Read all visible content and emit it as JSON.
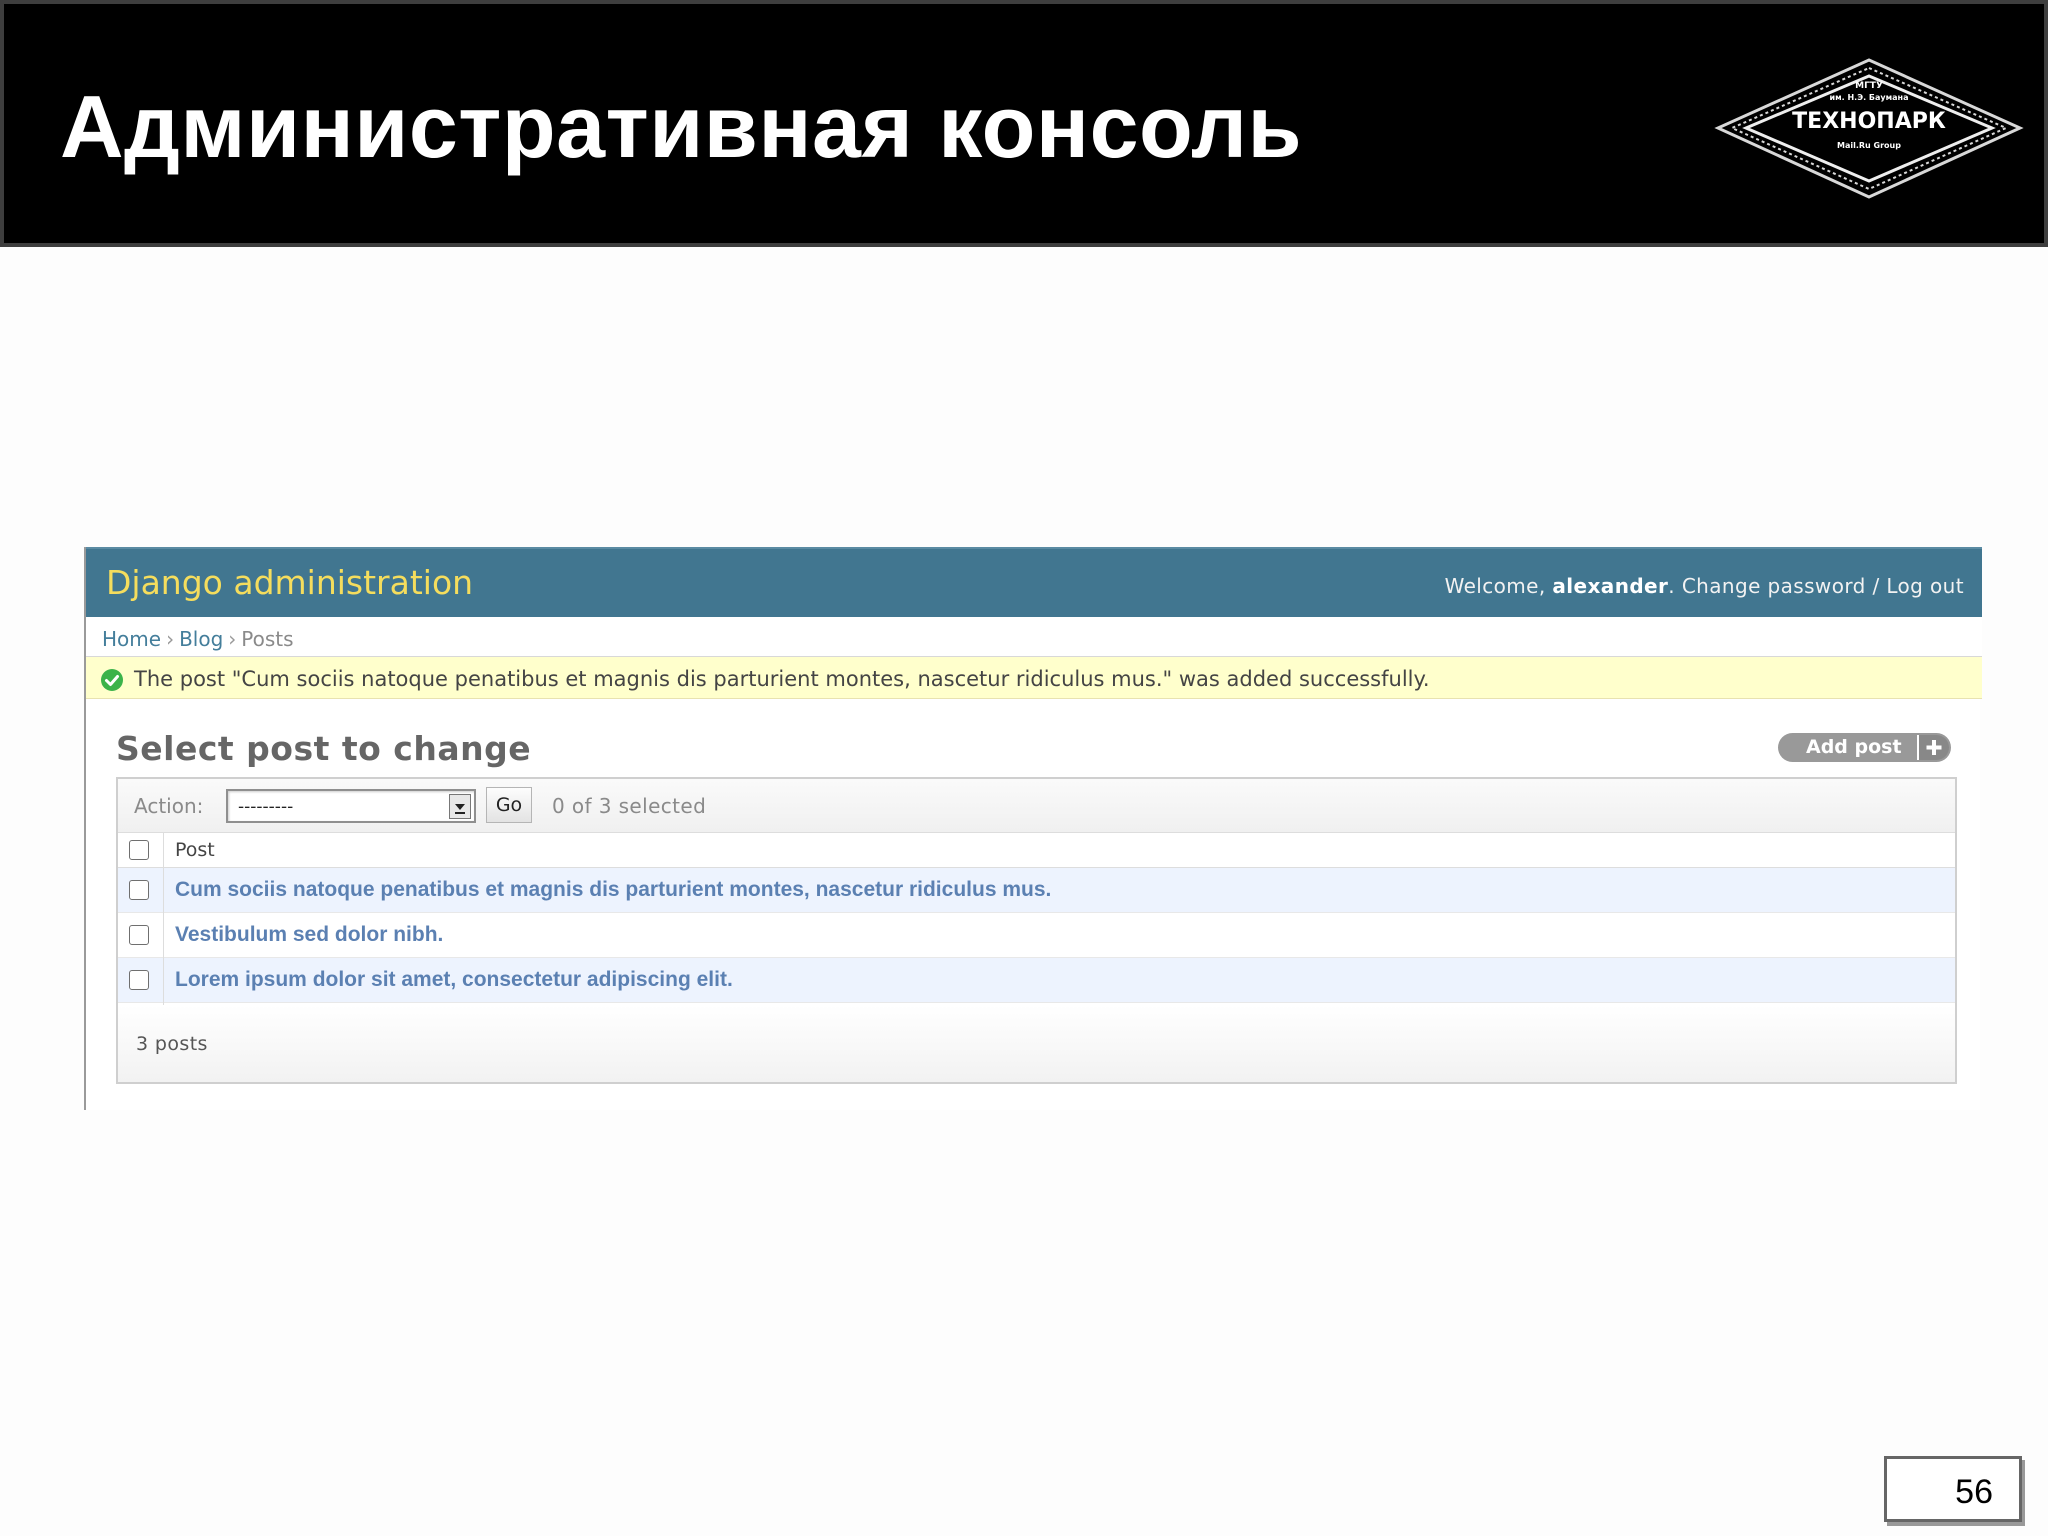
{
  "slide": {
    "title": "Административная консоль",
    "page_number": "56",
    "logo": {
      "line1": "МГТУ",
      "line2": "им. Н.Э. Баумана",
      "name": "ТЕХНОПАРК",
      "line3": "Mail.Ru Group"
    }
  },
  "admin": {
    "brand": "Django administration",
    "user_tools": {
      "welcome": "Welcome, ",
      "username": "alexander",
      "period": ". ",
      "change_password": "Change password",
      "separator": " / ",
      "logout": "Log out"
    },
    "breadcrumbs": {
      "home": "Home",
      "sep": "›",
      "blog": "Blog",
      "current": "Posts"
    },
    "message": "The post \"Cum sociis natoque penatibus et magnis dis parturient montes, nascetur ridiculus mus.\" was added successfully.",
    "heading": "Select post to change",
    "add_button": "Add post",
    "actions": {
      "label": "Action:",
      "selected_value": "---------",
      "go_label": "Go",
      "counter": "0 of 3 selected"
    },
    "table": {
      "column": "Post",
      "rows": [
        "Cum sociis natoque penatibus et magnis dis parturient montes, nascetur ridiculus mus.",
        "Vestibulum sed dolor nibh.",
        "Lorem ipsum dolor sit amet, consectetur adipiscing elit."
      ]
    },
    "paginator": "3 posts",
    "colors": {
      "header_bg": "#417690",
      "brand": "#f5dd5d",
      "link": "#5b80b2",
      "message_bg": "#ffffcc",
      "success_icon": "#4caf50"
    }
  },
  "icons": [
    "success-check-icon",
    "dropdown-arrow-icon",
    "plus-icon",
    "checkbox"
  ]
}
